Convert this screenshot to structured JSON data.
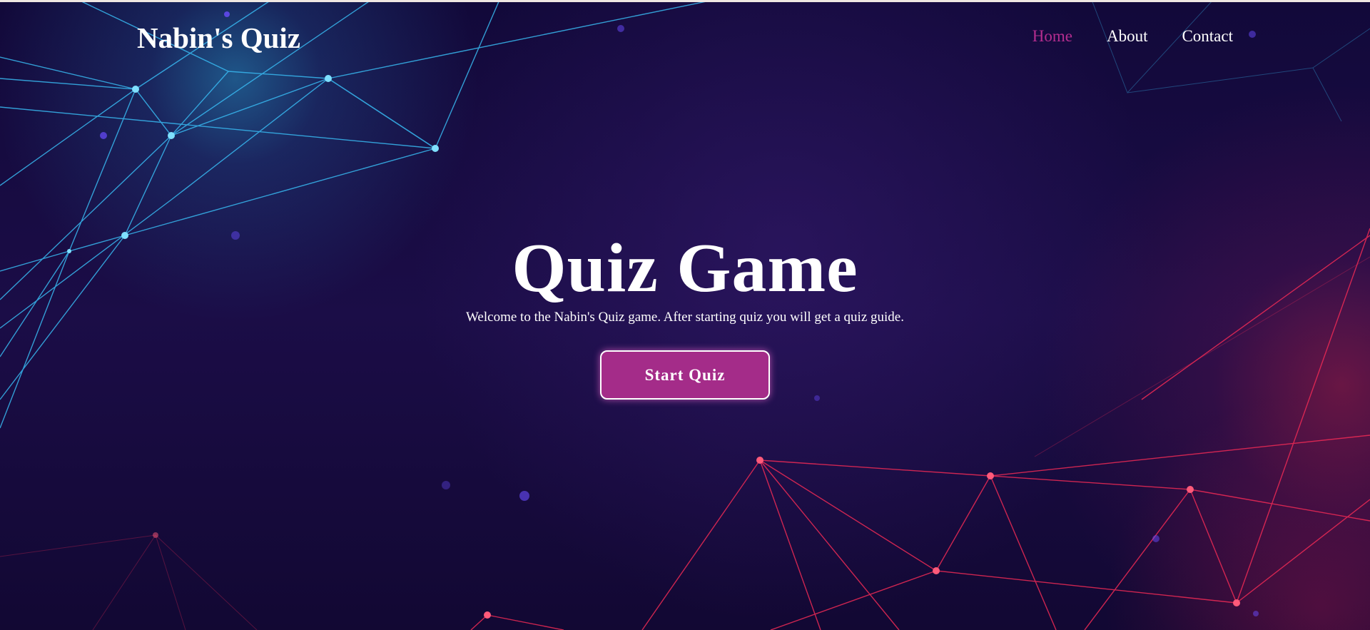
{
  "header": {
    "logo": "Nabin's Quiz",
    "nav": [
      {
        "label": "Home",
        "active": true
      },
      {
        "label": "About",
        "active": false
      },
      {
        "label": "Contact",
        "active": false
      }
    ]
  },
  "hero": {
    "title": "Quiz Game",
    "subtitle": "Welcome to the Nabin's Quiz game. After starting quiz you will get a quiz guide.",
    "start_button": "Start Quiz"
  },
  "colors": {
    "background": "#140a35",
    "accent": "#a42c89",
    "nav_active": "#b42d8f",
    "network_blue": "#38b8f0",
    "network_red": "#ee2a55"
  }
}
